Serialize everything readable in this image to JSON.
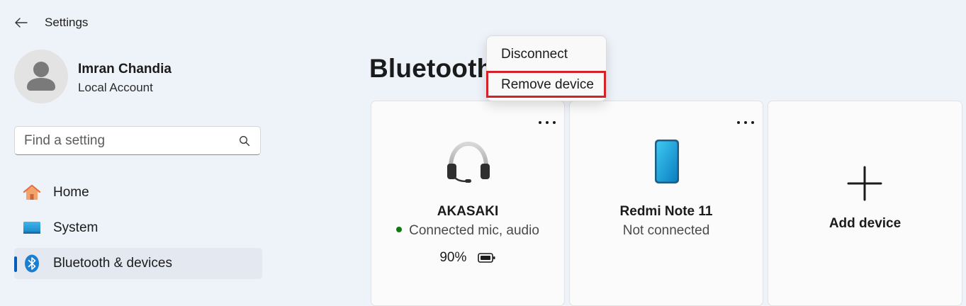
{
  "window": {
    "title": "Settings"
  },
  "user": {
    "name": "Imran Chandia",
    "account_type": "Local Account"
  },
  "search": {
    "placeholder": "Find a setting"
  },
  "nav": {
    "items": [
      {
        "label": "Home",
        "icon": "home-icon",
        "selected": false
      },
      {
        "label": "System",
        "icon": "system-icon",
        "selected": false
      },
      {
        "label": "Bluetooth & devices",
        "icon": "bluetooth-icon",
        "selected": true
      }
    ]
  },
  "page": {
    "title": "Bluetooth"
  },
  "devices": [
    {
      "name": "AKASAKI",
      "status": "Connected mic, audio",
      "connected": true,
      "battery": "90%",
      "icon": "headset-icon"
    },
    {
      "name": "Redmi Note 11",
      "status": "Not connected",
      "connected": false,
      "icon": "phone-icon"
    }
  ],
  "add_device": {
    "label": "Add device"
  },
  "context_menu": {
    "items": [
      {
        "label": "Disconnect"
      },
      {
        "label": "Remove device",
        "highlighted": true
      }
    ]
  },
  "colors": {
    "accent": "#005fb8",
    "connected": "#0f7b0f",
    "highlight": "#d2232a",
    "background": "#eef2f9"
  }
}
